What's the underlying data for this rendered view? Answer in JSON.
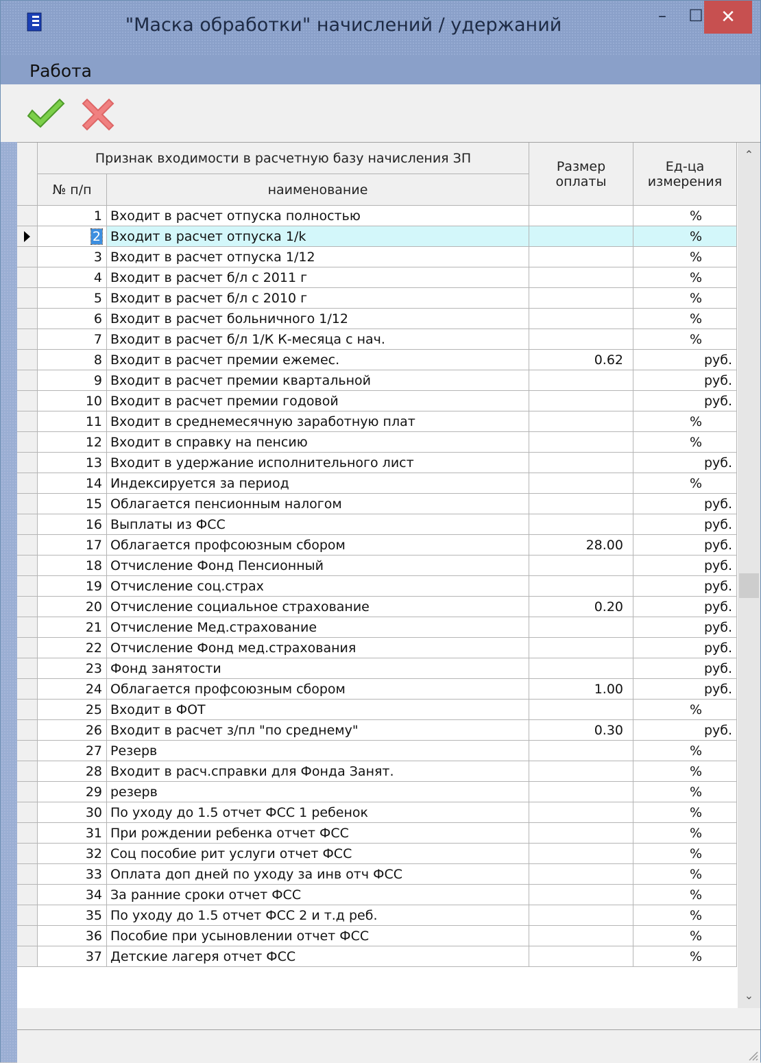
{
  "window": {
    "title": "\"Маска обработки\"  начислений / удержаний",
    "minimize_glyph": "–",
    "maximize_glyph": "☐",
    "close_glyph": "✕"
  },
  "menu": {
    "work": "Работа"
  },
  "toolbar": {
    "ok_icon": "green-checkmark-icon",
    "cancel_icon": "red-cross-icon"
  },
  "grid": {
    "group_header": "Признак входимости в расчетную базу начисления ЗП",
    "col_no": "№ п/п",
    "col_name": "наименование",
    "col_amount": "Размер оплаты",
    "col_unit": "Ед-ца измерения",
    "selected_index": 2,
    "rows": [
      {
        "no": "1",
        "name": "Входит в расчет отпуска полностью",
        "amount": "",
        "unit": "%"
      },
      {
        "no": "2",
        "name": "Входит в расчет отпуска 1/k",
        "amount": "",
        "unit": "%"
      },
      {
        "no": "3",
        "name": "Входит в расчет отпуска 1/12",
        "amount": "",
        "unit": "%"
      },
      {
        "no": "4",
        "name": "Входит в расчет б/л с 2011 г",
        "amount": "",
        "unit": "%"
      },
      {
        "no": "5",
        "name": "Входит в расчет б/л с 2010 г",
        "amount": "",
        "unit": "%"
      },
      {
        "no": "6",
        "name": "Входит в расчет больничного 1/12",
        "amount": "",
        "unit": "%"
      },
      {
        "no": "7",
        "name": "Входит в расчет б/л 1/К К-месяца с нач.",
        "amount": "",
        "unit": "%"
      },
      {
        "no": "8",
        "name": "Входит в расчет премии ежемес.",
        "amount": "0.62",
        "unit": "руб."
      },
      {
        "no": "9",
        "name": "Входит в расчет премии квартальной",
        "amount": "",
        "unit": "руб."
      },
      {
        "no": "10",
        "name": "Входит в расчет премии годовой",
        "amount": "",
        "unit": "руб."
      },
      {
        "no": "11",
        "name": "Входит в среднемесячную заработную плат",
        "amount": "",
        "unit": "%"
      },
      {
        "no": "12",
        "name": "Входит в справку на пенсию",
        "amount": "",
        "unit": "%"
      },
      {
        "no": "13",
        "name": "Входит в удержание исполнительного лист",
        "amount": "",
        "unit": "руб."
      },
      {
        "no": "14",
        "name": "Индексируется за период",
        "amount": "",
        "unit": "%"
      },
      {
        "no": "15",
        "name": "Облагается пенсионным налогом",
        "amount": "",
        "unit": "руб."
      },
      {
        "no": "16",
        "name": "Выплаты из ФСС",
        "amount": "",
        "unit": "руб."
      },
      {
        "no": "17",
        "name": "Облагается профсоюзным сбором",
        "amount": "28.00",
        "unit": "руб."
      },
      {
        "no": "18",
        "name": "Отчисление Фонд Пенсионный",
        "amount": "",
        "unit": "руб."
      },
      {
        "no": "19",
        "name": "Отчисление соц.страх",
        "amount": "",
        "unit": "руб."
      },
      {
        "no": "20",
        "name": "Отчисление социальное страхование",
        "amount": "0.20",
        "unit": "руб."
      },
      {
        "no": "21",
        "name": "Отчисление Мед.страхование",
        "amount": "",
        "unit": "руб."
      },
      {
        "no": "22",
        "name": "Отчисление Фонд мед.страхования",
        "amount": "",
        "unit": "руб."
      },
      {
        "no": "23",
        "name": "Фонд занятости",
        "amount": "",
        "unit": "руб."
      },
      {
        "no": "24",
        "name": "Облагается профсоюзным сбором",
        "amount": "1.00",
        "unit": "руб."
      },
      {
        "no": "25",
        "name": "Входит в ФОТ",
        "amount": "",
        "unit": "%"
      },
      {
        "no": "26",
        "name": "Входит в расчет з/пл \"по среднему\"",
        "amount": "0.30",
        "unit": "руб."
      },
      {
        "no": "27",
        "name": "Резерв",
        "amount": "",
        "unit": "%"
      },
      {
        "no": "28",
        "name": "Входит в расч.справки для Фонда Занят.",
        "amount": "",
        "unit": "%"
      },
      {
        "no": "29",
        "name": "резерв",
        "amount": "",
        "unit": "%"
      },
      {
        "no": "30",
        "name": "По уходу до 1.5 отчет ФСС 1 ребенок",
        "amount": "",
        "unit": "%"
      },
      {
        "no": "31",
        "name": "При рождении ребенка отчет ФСС",
        "amount": "",
        "unit": "%"
      },
      {
        "no": "32",
        "name": "Соц пособие рит услуги отчет ФСС",
        "amount": "",
        "unit": "%"
      },
      {
        "no": "33",
        "name": "Оплата доп дней по уходу за инв отч ФСС",
        "amount": "",
        "unit": "%"
      },
      {
        "no": "34",
        "name": "За ранние сроки отчет ФСС",
        "amount": "",
        "unit": "%"
      },
      {
        "no": "35",
        "name": "По уходу до 1.5 отчет ФСС 2 и т.д реб.",
        "amount": "",
        "unit": "%"
      },
      {
        "no": "36",
        "name": "Пособие при усыновлении отчет ФСС",
        "amount": "",
        "unit": "%"
      },
      {
        "no": "37",
        "name": "Детские лагеря отчет ФСС",
        "amount": "",
        "unit": "%"
      }
    ]
  }
}
